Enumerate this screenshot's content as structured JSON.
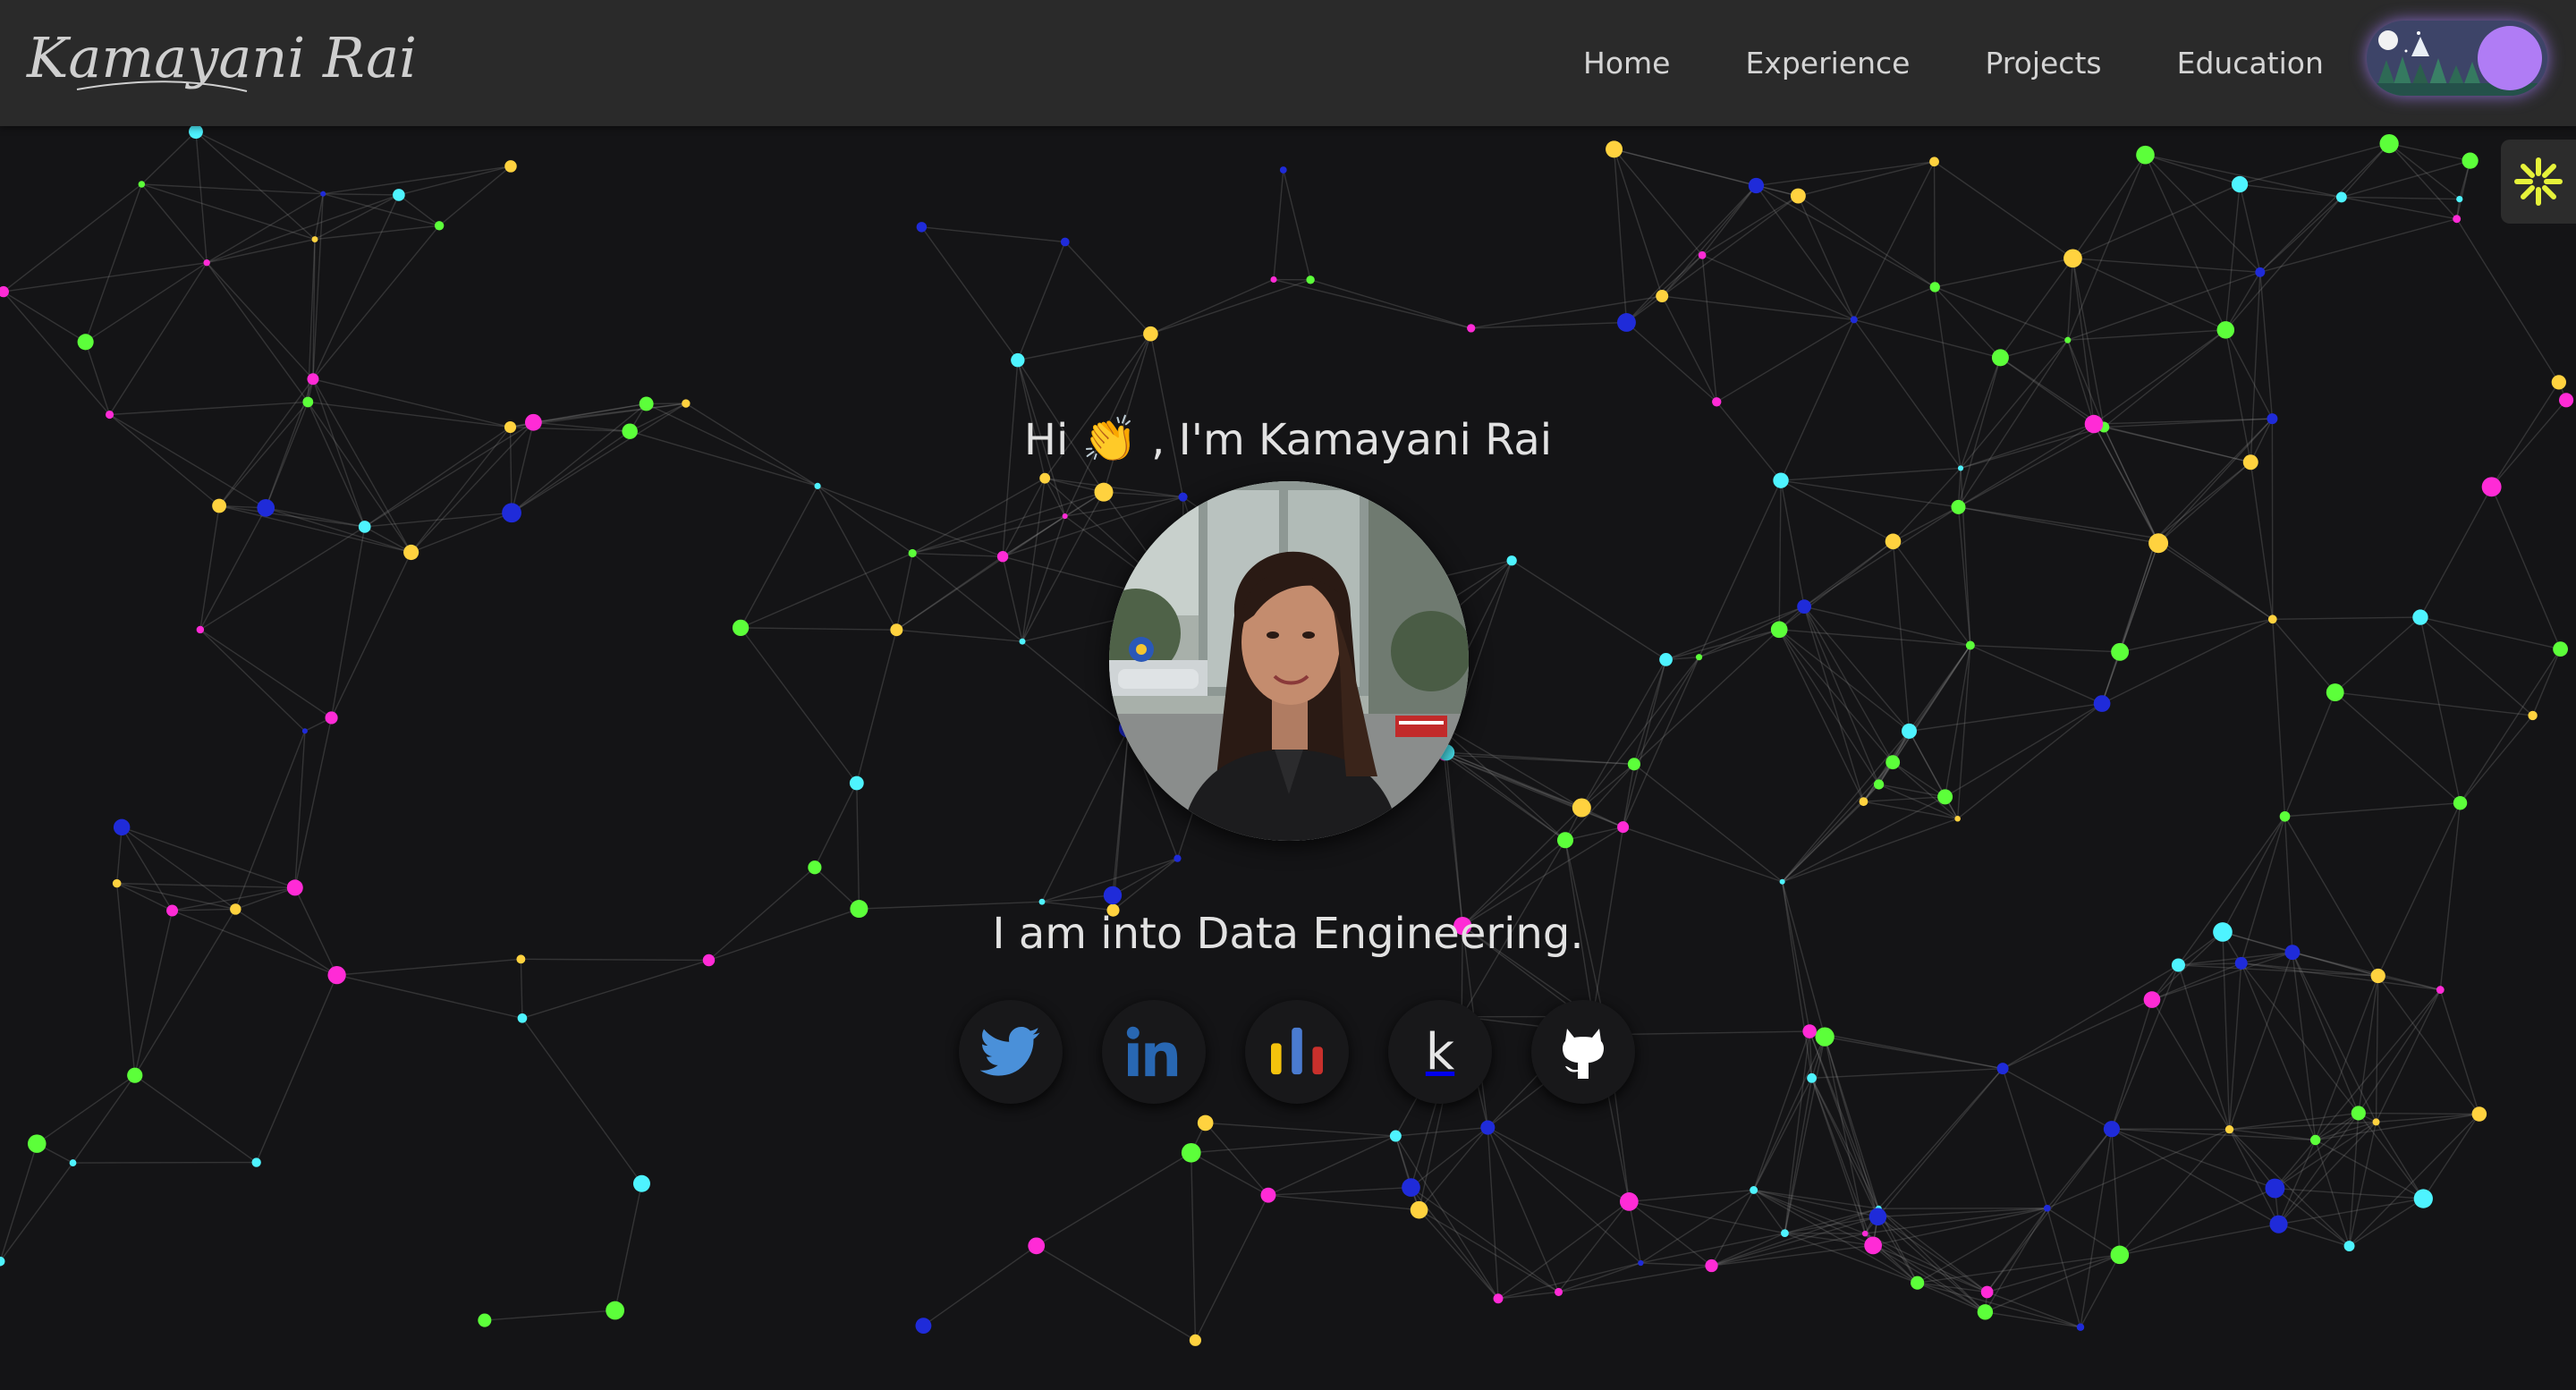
{
  "brand": {
    "logo_text": "Kamayani Rai"
  },
  "nav": {
    "links": [
      {
        "label": "Home"
      },
      {
        "label": "Experience"
      },
      {
        "label": "Projects"
      },
      {
        "label": "Education"
      }
    ],
    "theme_toggle": {
      "state": "dark"
    }
  },
  "hero": {
    "greeting_prefix": "Hi",
    "greeting_emoji": "👏",
    "greeting_suffix": ", I'm Kamayani Rai",
    "tagline": "I am into Data Engineering."
  },
  "socials": [
    {
      "name": "Twitter",
      "icon": "twitter-bird-icon",
      "color": "#4a90d9"
    },
    {
      "name": "LinkedIn",
      "icon": "linkedin-icon",
      "color": "#2867b2"
    },
    {
      "name": "Data Visualization",
      "icon": "bar-chart-icon",
      "colors": [
        "#f4c20d",
        "#4a7bd0",
        "#c9302c"
      ]
    },
    {
      "name": "Kaggle",
      "icon": "kaggle-icon",
      "glyph": "k"
    },
    {
      "name": "GitHub",
      "icon": "github-octocat-icon",
      "color": "#ffffff"
    }
  ],
  "theme": {
    "background": "#141416",
    "navbar": "#2a2a2a",
    "text": "#e2e2e2",
    "particle_colors": [
      "#ff2bd6",
      "#4ef3ff",
      "#ffd23f",
      "#5cff3a",
      "#1f2bd9"
    ]
  }
}
